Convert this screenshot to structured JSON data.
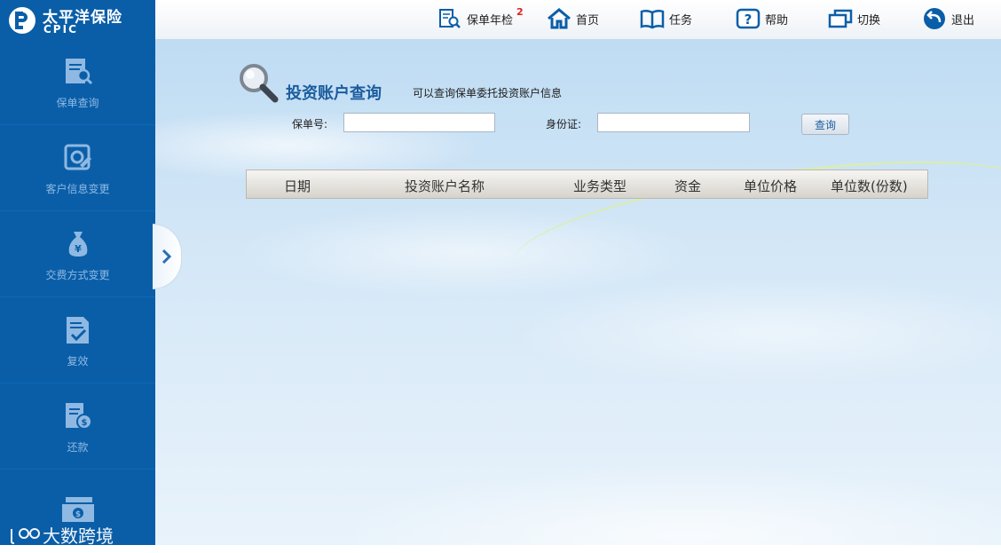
{
  "brand": {
    "name_cn": "太平洋保险",
    "name_en": "CPIC",
    "color": "#0a5ea8"
  },
  "topnav": [
    {
      "label": "保单年检",
      "icon": "document-search-icon",
      "badge": "2"
    },
    {
      "label": "首页",
      "icon": "home-icon"
    },
    {
      "label": "任务",
      "icon": "book-icon"
    },
    {
      "label": "帮助",
      "icon": "help-icon"
    },
    {
      "label": "切换",
      "icon": "switch-window-icon"
    },
    {
      "label": "退出",
      "icon": "logout-icon"
    }
  ],
  "sidebar": {
    "items": [
      {
        "label": "保单查询",
        "icon": "policy-query-icon"
      },
      {
        "label": "客户信息变更",
        "icon": "customer-info-icon"
      },
      {
        "label": "交费方式变更",
        "icon": "payment-method-icon"
      },
      {
        "label": "复效",
        "icon": "reinstatement-icon"
      },
      {
        "label": "还款",
        "icon": "repayment-icon"
      },
      {
        "label": "",
        "icon": "cash-icon"
      }
    ]
  },
  "watermark": "大数跨境",
  "main": {
    "title": "投资账户查询",
    "description": "可以查询保单委托投资账户信息",
    "form": {
      "policy_label": "保单号:",
      "policy_value": "",
      "id_label": "身份证:",
      "id_value": "",
      "query_button": "查询"
    },
    "table": {
      "columns": [
        "日期",
        "投资账户名称",
        "业务类型",
        "资金",
        "单位价格",
        "单位数(份数)"
      ]
    }
  }
}
